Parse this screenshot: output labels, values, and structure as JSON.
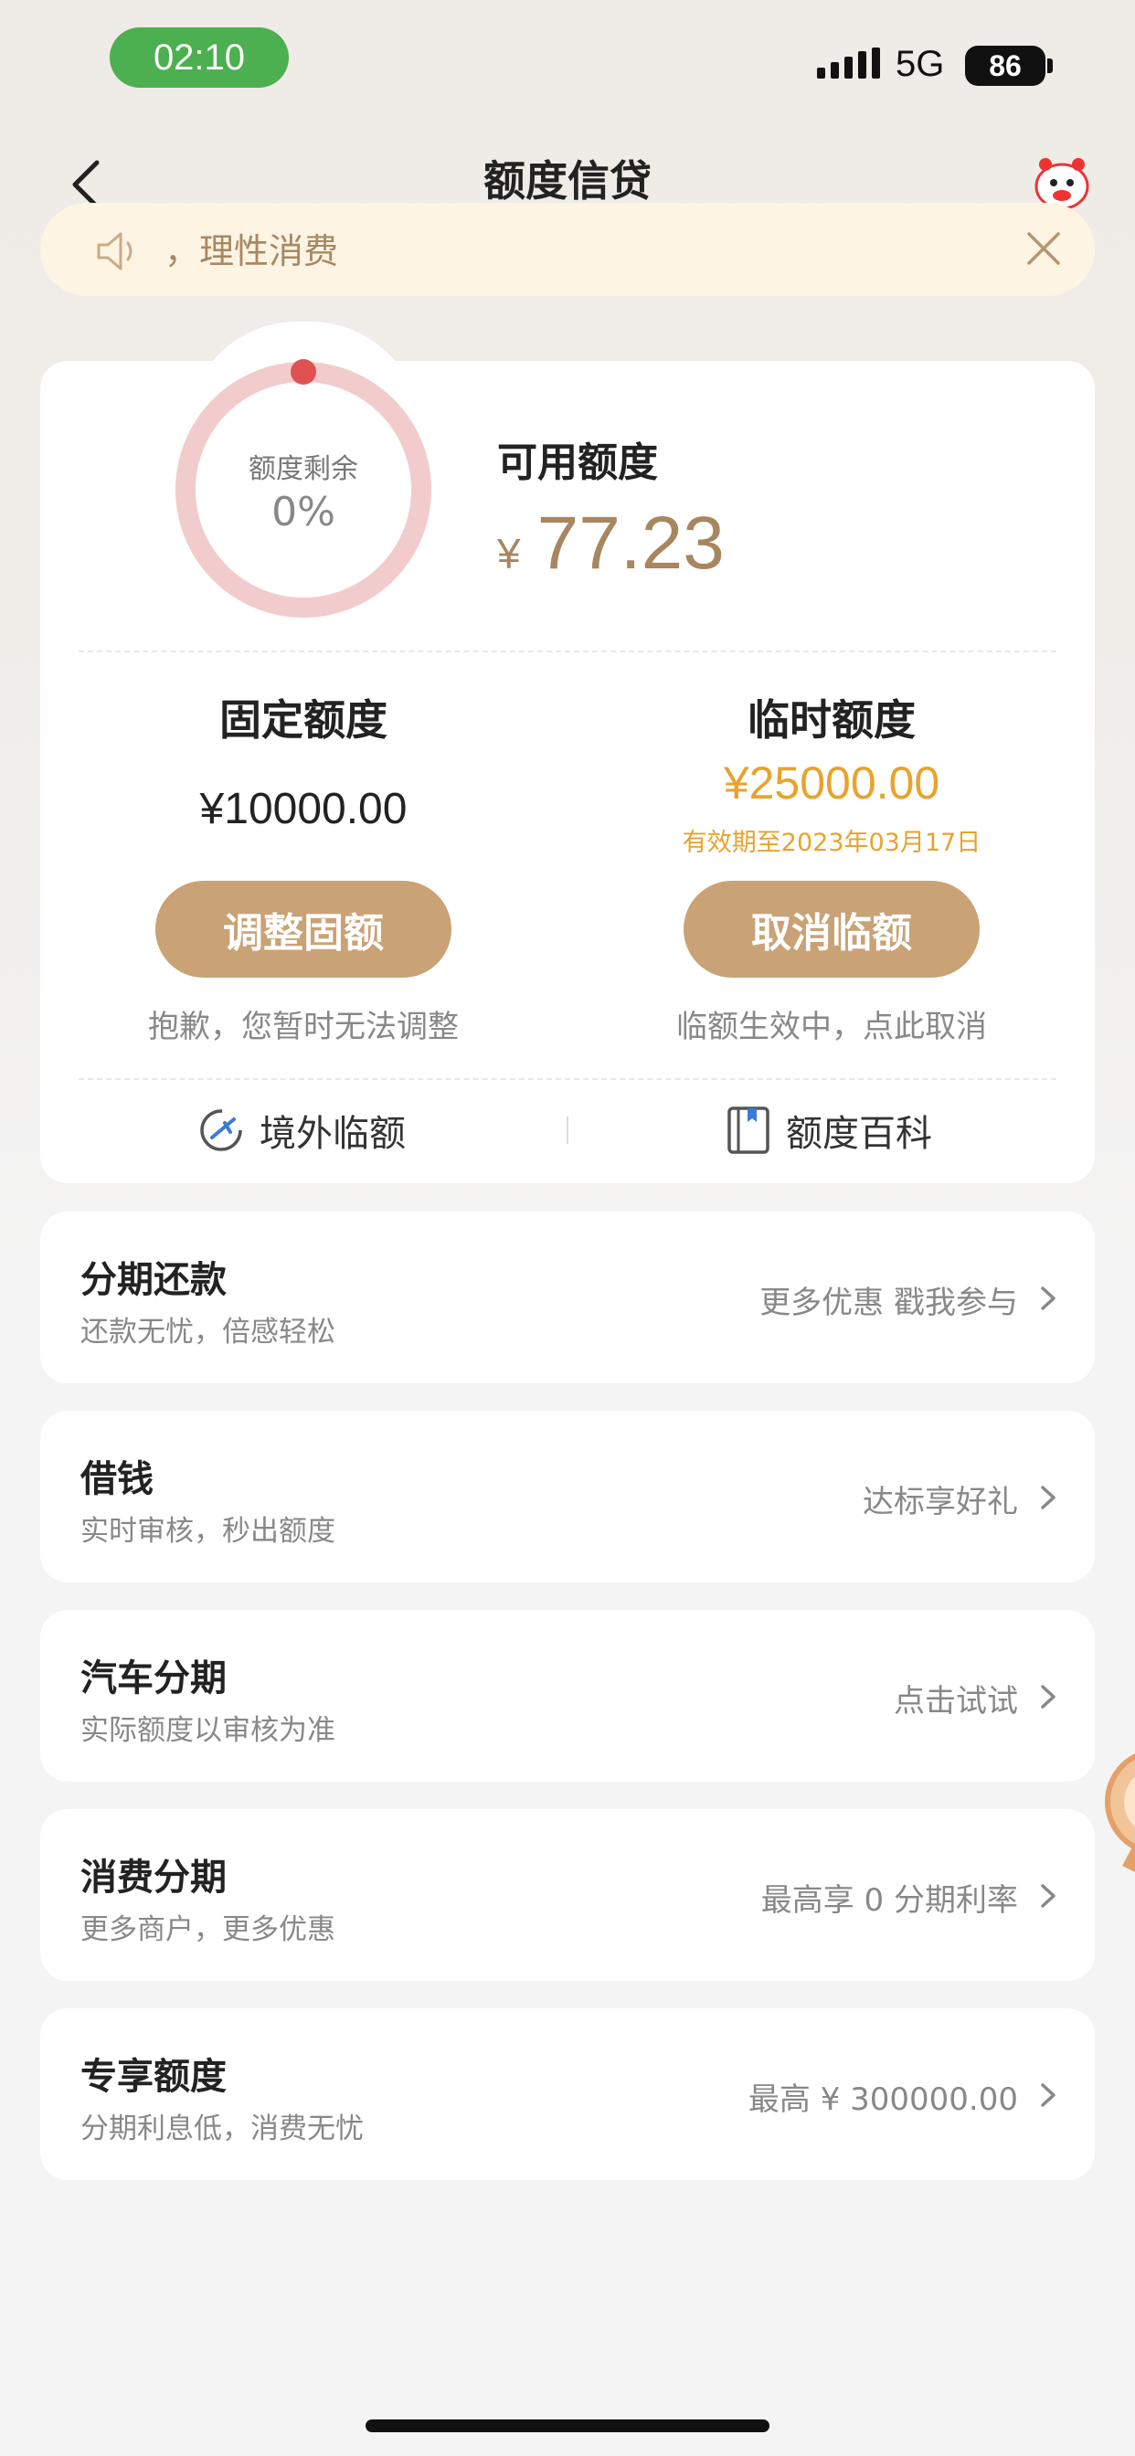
{
  "status_bar": {
    "time": "02:10",
    "network": "5G",
    "battery": "86"
  },
  "header": {
    "title": "额度信贷"
  },
  "notice": {
    "text": "，理性消费"
  },
  "quota": {
    "ring_label": "额度剩余",
    "ring_percent": "0%",
    "available_label": "可用额度",
    "currency": "¥",
    "available_amount": "77.23"
  },
  "fixed": {
    "title": "固定额度",
    "amount": "¥10000.00",
    "button": "调整固额",
    "hint": "抱歉，您暂时无法调整"
  },
  "temporary": {
    "title": "临时额度",
    "amount": "¥25000.00",
    "validity": "有效期至2023年03月17日",
    "button": "取消临额",
    "hint": "临额生效中，点此取消"
  },
  "links": {
    "overseas": "境外临额",
    "wiki": "额度百科"
  },
  "items": [
    {
      "title": "分期还款",
      "subtitle": "还款无忧，倍感轻松",
      "right": "更多优惠 戳我参与"
    },
    {
      "title": "借钱",
      "subtitle": "实时审核，秒出额度",
      "right": "达标享好礼"
    },
    {
      "title": "汽车分期",
      "subtitle": "实际额度以审核为准",
      "right": "点击试试"
    },
    {
      "title": "消费分期",
      "subtitle": "更多商户，更多优惠",
      "right": "最高享 0 分期利率"
    },
    {
      "title": "专享额度",
      "subtitle": "分期利息低，消费无忧",
      "right": "最高 ¥ 300000.00"
    }
  ],
  "colors": {
    "accent": "#c9a276",
    "amount_gold": "#a8865f",
    "temp_orange": "#e8a32c",
    "ring": "#f2cccc",
    "ring_dot": "#e05252"
  }
}
